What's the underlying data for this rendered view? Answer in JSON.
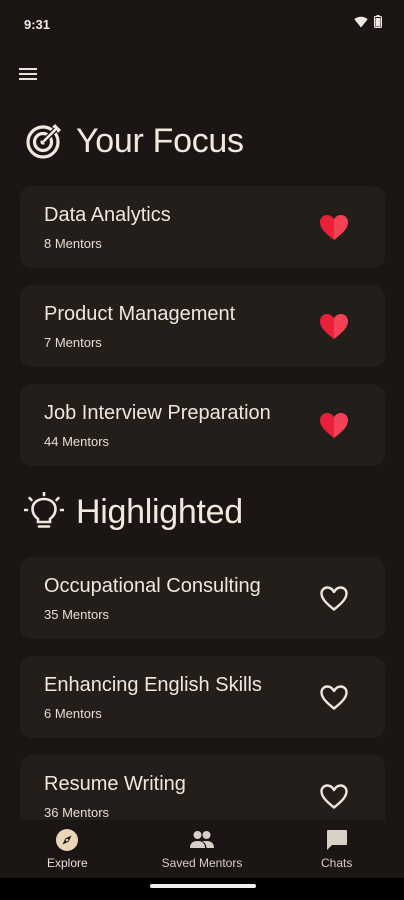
{
  "status_bar": {
    "time": "9:31"
  },
  "focus_section": {
    "title": "Your Focus",
    "items": [
      {
        "title": "Data Analytics",
        "mentors": "8 Mentors",
        "favorited": true
      },
      {
        "title": "Product Management",
        "mentors": "7 Mentors",
        "favorited": true
      },
      {
        "title": "Job Interview Preparation",
        "mentors": "44 Mentors",
        "favorited": true
      }
    ]
  },
  "highlighted_section": {
    "title": "Highlighted",
    "items": [
      {
        "title": "Occupational Consulting",
        "mentors": "35 Mentors",
        "favorited": false
      },
      {
        "title": "Enhancing English Skills",
        "mentors": "6 Mentors",
        "favorited": false
      },
      {
        "title": "Resume Writing",
        "mentors": "36 Mentors",
        "favorited": false
      }
    ]
  },
  "bottom_nav": {
    "items": [
      {
        "label": "Explore",
        "icon": "compass-icon",
        "active": true
      },
      {
        "label": "Saved Mentors",
        "icon": "people-icon",
        "active": false
      },
      {
        "label": "Chats",
        "icon": "chat-icon",
        "active": false
      }
    ]
  },
  "colors": {
    "background": "#1b1613",
    "card": "#241e1a",
    "heart_filled": "#e8203a",
    "text": "#efe6dc"
  }
}
